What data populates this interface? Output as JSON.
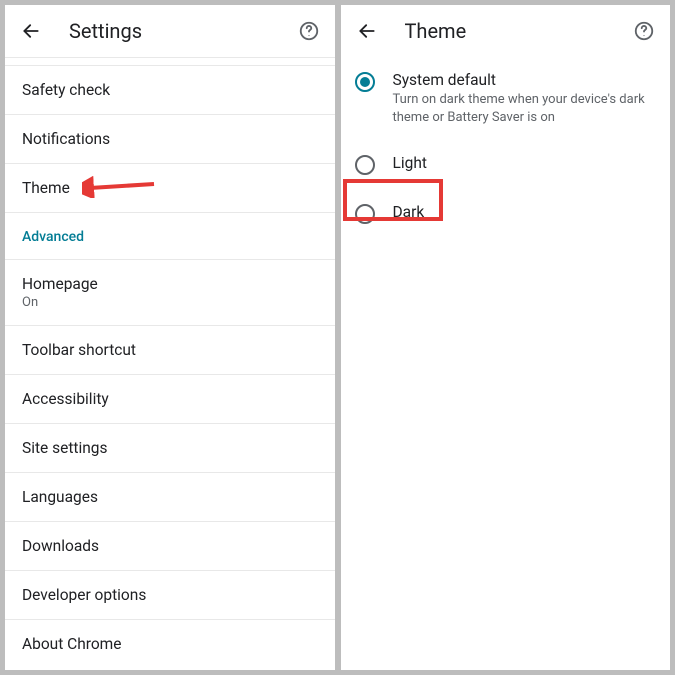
{
  "left": {
    "title": "Settings",
    "partial_top": "",
    "items": {
      "safety_check": "Safety check",
      "notifications": "Notifications",
      "theme": "Theme",
      "advanced_header": "Advanced",
      "homepage": "Homepage",
      "homepage_sub": "On",
      "toolbar_shortcut": "Toolbar shortcut",
      "accessibility": "Accessibility",
      "site_settings": "Site settings",
      "languages": "Languages",
      "downloads": "Downloads",
      "developer_options": "Developer options",
      "about_chrome": "About Chrome"
    }
  },
  "right": {
    "title": "Theme",
    "options": {
      "system_default": {
        "label": "System default",
        "desc": "Turn on dark theme when your device's dark theme or Battery Saver is on"
      },
      "light": {
        "label": "Light"
      },
      "dark": {
        "label": "Dark"
      }
    }
  }
}
